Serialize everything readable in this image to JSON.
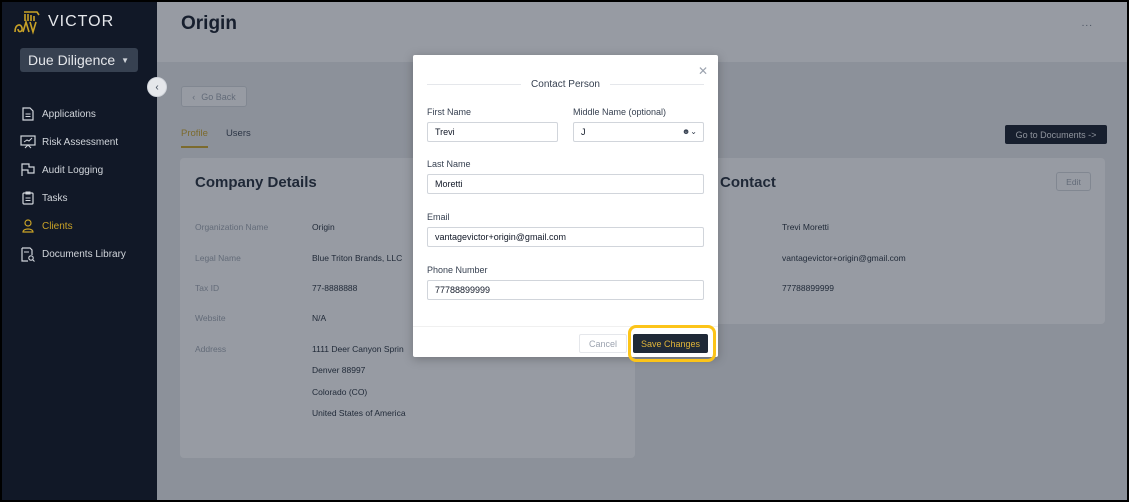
{
  "app": {
    "logo_text": "VICTOR",
    "module": "Due Diligence"
  },
  "sidebar": {
    "items": [
      {
        "label": "Applications",
        "icon": "document-icon",
        "active": false
      },
      {
        "label": "Risk Assessment",
        "icon": "presentation-chart-icon",
        "active": false
      },
      {
        "label": "Audit Logging",
        "icon": "flag-icon",
        "active": false
      },
      {
        "label": "Tasks",
        "icon": "clipboard-icon",
        "active": false
      },
      {
        "label": "Clients",
        "icon": "user-icon",
        "active": true
      },
      {
        "label": "Documents Library",
        "icon": "document-search-icon",
        "active": false
      }
    ]
  },
  "header": {
    "title": "Origin",
    "more_label": "..."
  },
  "page": {
    "go_back_label": "Go Back",
    "tabs": [
      {
        "label": "Profile",
        "active": true
      },
      {
        "label": "Users",
        "active": false
      }
    ],
    "go_to_documents_label": "Go to Documents ->",
    "company": {
      "title": "Company Details",
      "rows": [
        {
          "label": "Organization Name",
          "value": "Origin"
        },
        {
          "label": "Legal Name",
          "value": "Blue Triton Brands, LLC"
        },
        {
          "label": "Tax ID",
          "value": "77-8888888"
        },
        {
          "label": "Website",
          "value": "N/A"
        },
        {
          "label": "Address",
          "value": "1111 Deer Canyon Sprin"
        }
      ],
      "address_lines": [
        "Denver 88997",
        "Colorado (CO)",
        "United States of America"
      ]
    },
    "contact": {
      "title": "Contact",
      "edit_label": "Edit",
      "values": [
        "Trevi Moretti",
        "vantagevictor+origin@gmail.com",
        "77788899999"
      ]
    }
  },
  "modal": {
    "title": "Contact Person",
    "fields": {
      "first_name": {
        "label": "First Name",
        "value": "Trevi"
      },
      "middle_name": {
        "label": "Middle Name (optional)",
        "value": "J"
      },
      "last_name": {
        "label": "Last Name",
        "value": "Moretti"
      },
      "email": {
        "label": "Email",
        "value": "vantagevictor+origin@gmail.com"
      },
      "phone": {
        "label": "Phone Number",
        "value": "77788899999"
      }
    },
    "cancel_label": "Cancel",
    "save_label": "Save Changes",
    "close_glyph": "✕"
  },
  "colors": {
    "accent": "#c9a227",
    "sidebar_bg": "#111827",
    "highlight": "#fcc419"
  }
}
